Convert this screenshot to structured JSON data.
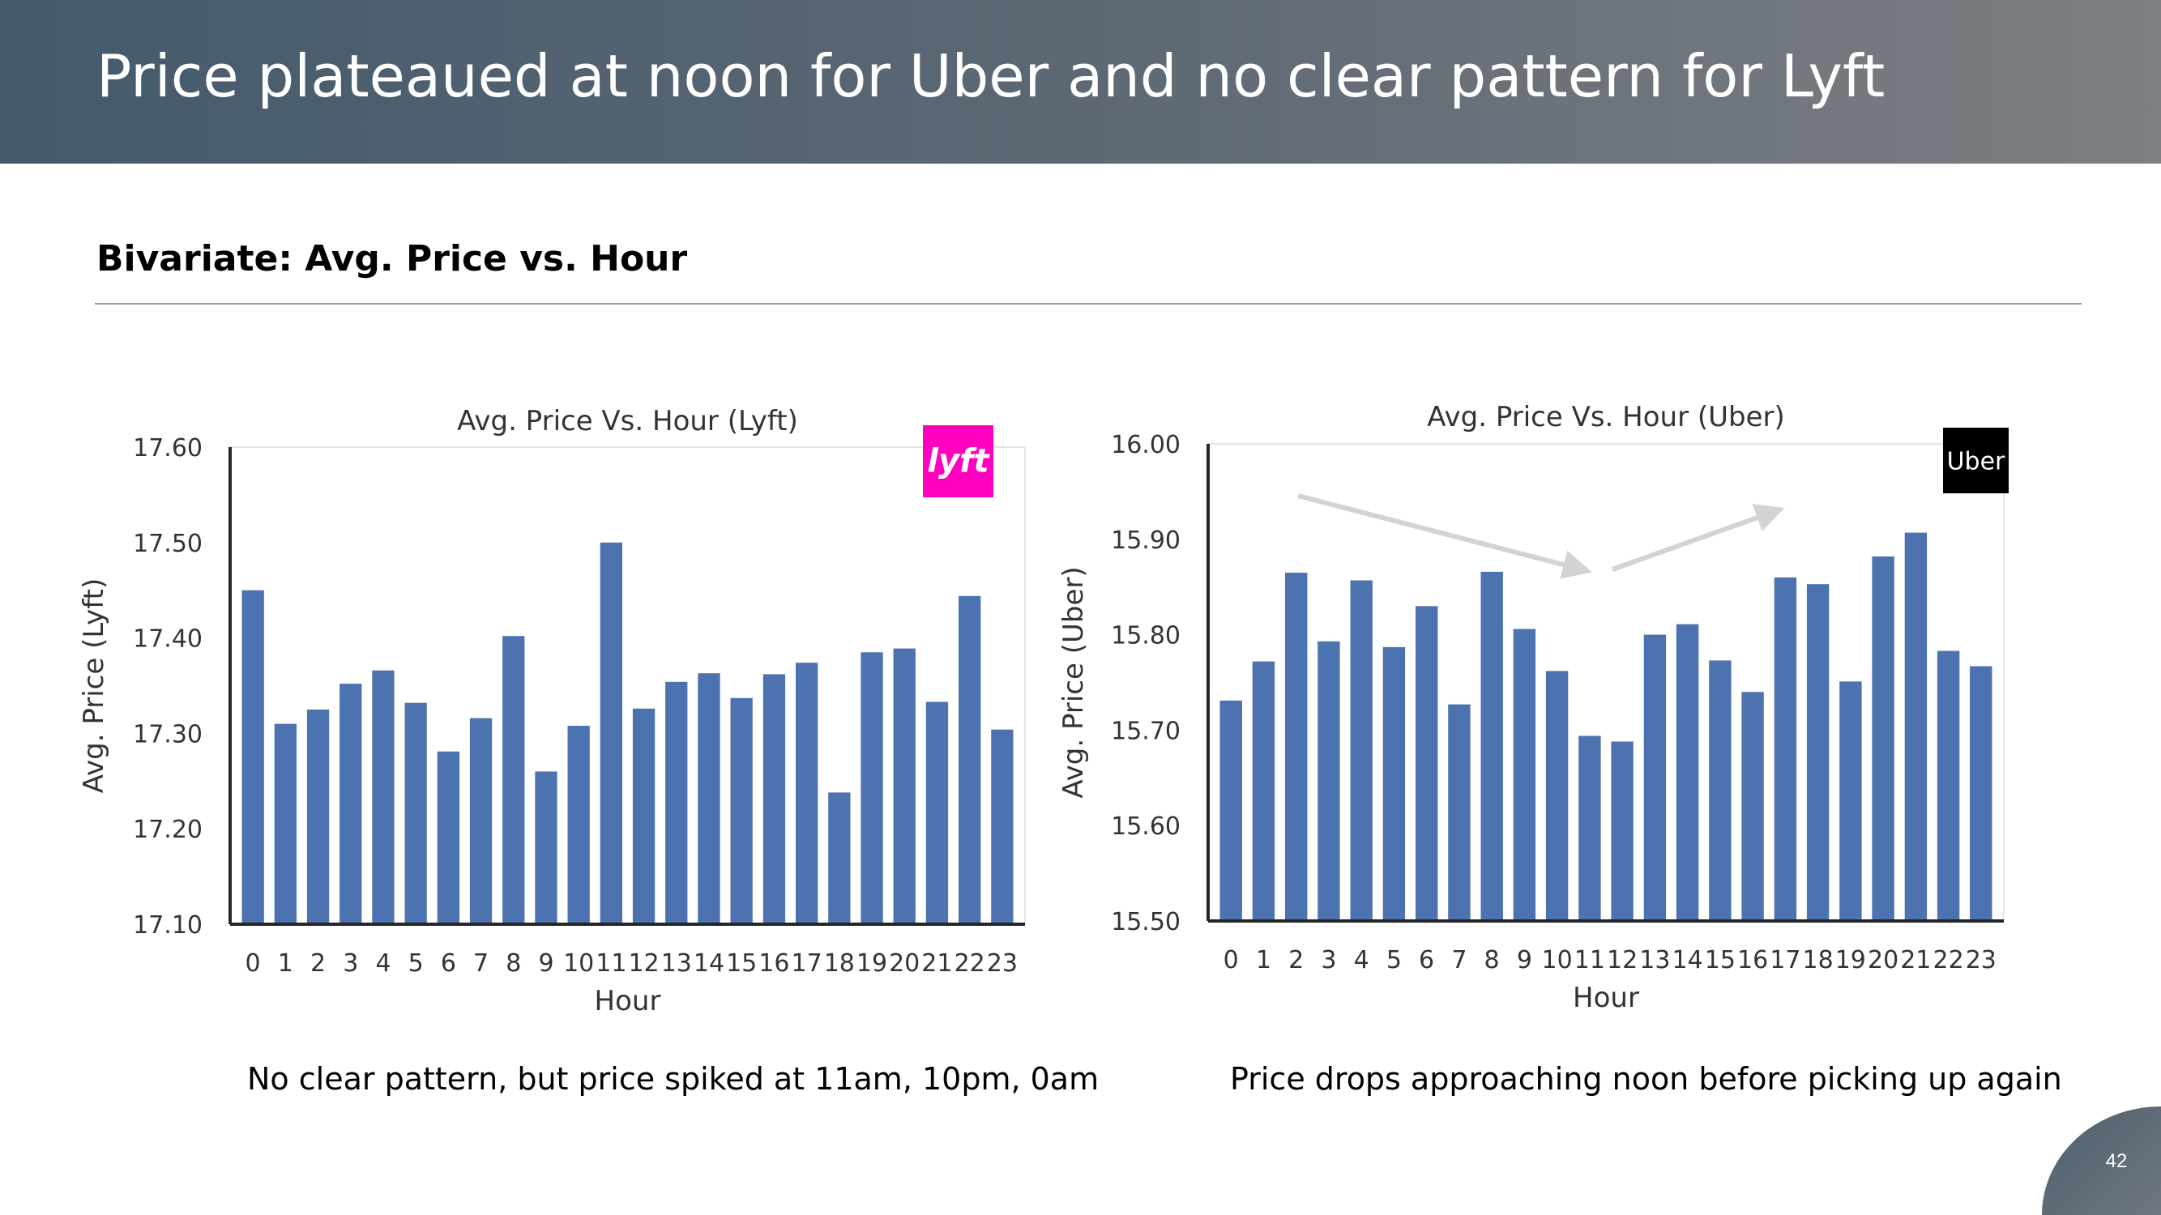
{
  "slide": {
    "title": "Price plateaued at noon for Uber and no clear pattern for Lyft",
    "subtitle": "Bivariate: Avg. Price vs. Hour",
    "page_number": "42"
  },
  "captions": {
    "lyft": "No clear pattern, but price spiked at 11am, 10pm, 0am",
    "uber": "Price drops approaching noon before picking up again"
  },
  "logos": {
    "lyft": {
      "text": "lyft",
      "color": "#ff00bf"
    },
    "uber": {
      "text": "Uber",
      "color": "#000000"
    }
  },
  "colors": {
    "bar": "#4c72b0",
    "arrow": "#d3d3d3"
  },
  "chart_data": [
    {
      "id": "lyft",
      "type": "bar",
      "title": "Avg. Price Vs. Hour (Lyft)",
      "xlabel": "Hour",
      "ylabel": "Avg. Price (Lyft)",
      "ylim": [
        17.1,
        17.6
      ],
      "yticks": [
        "17.10",
        "17.20",
        "17.30",
        "17.40",
        "17.50",
        "17.60"
      ],
      "categories": [
        "0",
        "1",
        "2",
        "3",
        "4",
        "5",
        "6",
        "7",
        "8",
        "9",
        "10",
        "11",
        "12",
        "13",
        "14",
        "15",
        "16",
        "17",
        "18",
        "19",
        "20",
        "21",
        "22",
        "23"
      ],
      "values": [
        17.45,
        17.31,
        17.325,
        17.352,
        17.366,
        17.332,
        17.281,
        17.316,
        17.402,
        17.26,
        17.308,
        17.5,
        17.326,
        17.354,
        17.363,
        17.337,
        17.362,
        17.374,
        17.238,
        17.385,
        17.389,
        17.333,
        17.444,
        17.304
      ],
      "grid": false,
      "logo": "lyft"
    },
    {
      "id": "uber",
      "type": "bar",
      "title": "Avg. Price Vs. Hour (Uber)",
      "xlabel": "Hour",
      "ylabel": "Avg. Price (Uber)",
      "ylim": [
        15.5,
        16.0
      ],
      "yticks": [
        "15.50",
        "15.60",
        "15.70",
        "15.80",
        "15.90",
        "16.00"
      ],
      "categories": [
        "0",
        "1",
        "2",
        "3",
        "4",
        "5",
        "6",
        "7",
        "8",
        "9",
        "10",
        "11",
        "12",
        "13",
        "14",
        "15",
        "16",
        "17",
        "18",
        "19",
        "20",
        "21",
        "22",
        "23"
      ],
      "values": [
        15.731,
        15.772,
        15.865,
        15.793,
        15.857,
        15.787,
        15.83,
        15.727,
        15.866,
        15.806,
        15.762,
        15.694,
        15.688,
        15.8,
        15.811,
        15.773,
        15.74,
        15.86,
        15.853,
        15.751,
        15.882,
        15.907,
        15.783,
        15.767
      ],
      "grid": false,
      "logo": "uber",
      "annotations": [
        "down-arrow",
        "up-arrow"
      ]
    }
  ]
}
